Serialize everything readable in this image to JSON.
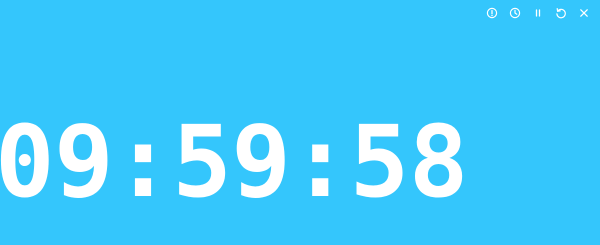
{
  "timer": {
    "display": "09:59:58"
  },
  "toolbar": {
    "buttons": [
      {
        "name": "info-icon"
      },
      {
        "name": "clock-icon"
      },
      {
        "name": "pause-icon"
      },
      {
        "name": "reset-icon"
      },
      {
        "name": "close-icon"
      }
    ]
  },
  "colors": {
    "background": "#34c6fc",
    "foreground": "#ffffff"
  }
}
